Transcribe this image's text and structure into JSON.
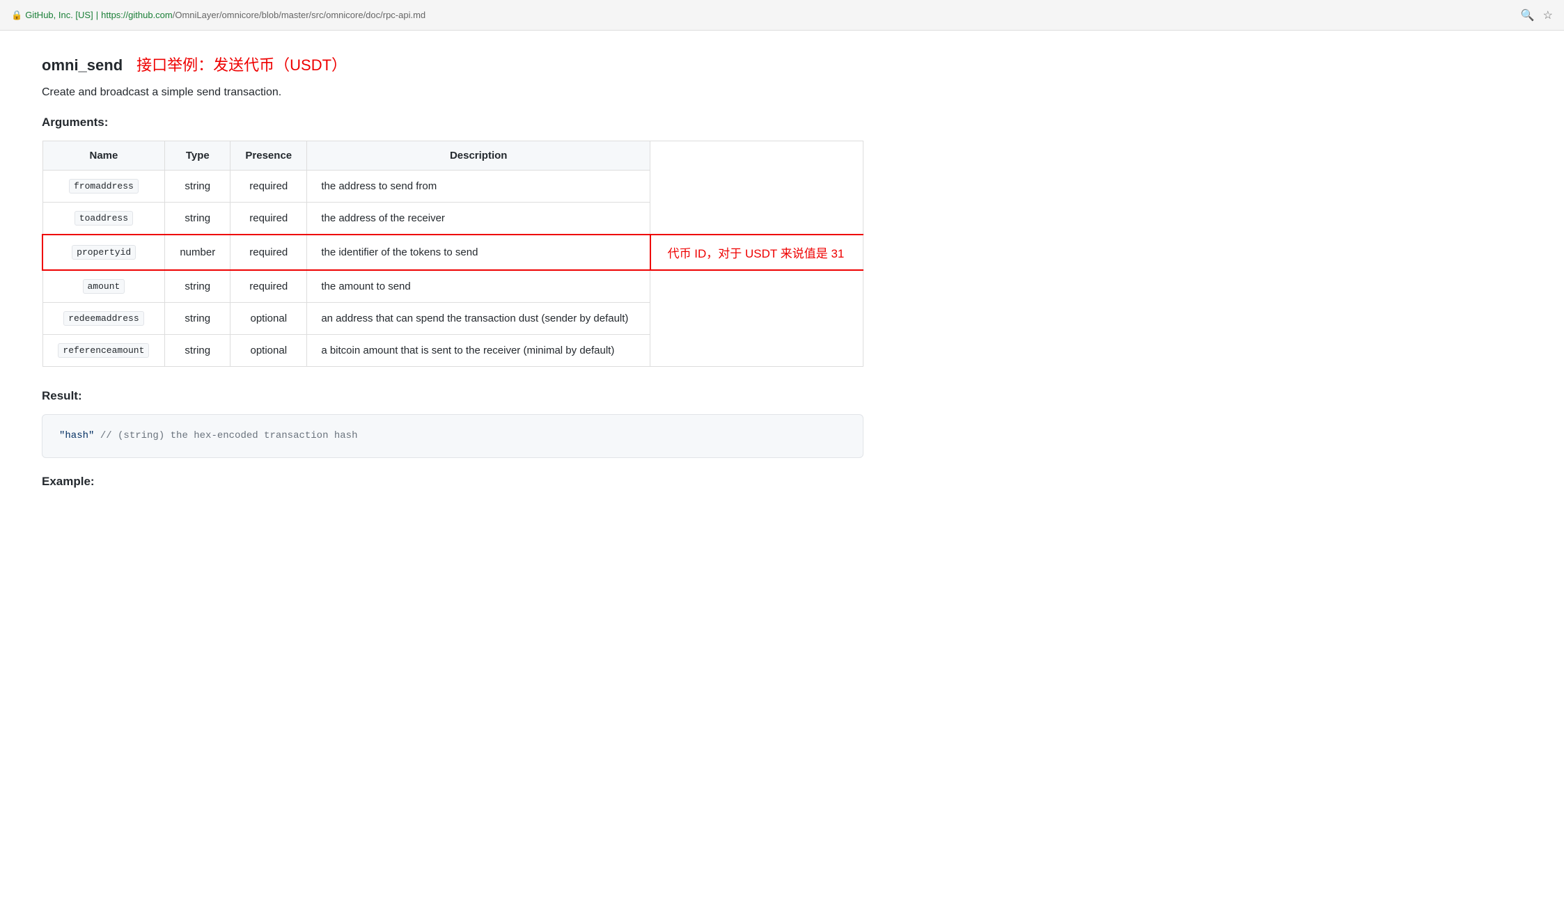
{
  "browser": {
    "security_label": "GitHub, Inc. [US]",
    "url_domain": "https://github.com",
    "url_path": "/OmniLayer/omnicore/blob/master/src/omnicore/doc/rpc-api.md",
    "search_icon": "🔍",
    "star_icon": "☆"
  },
  "page": {
    "api_title": "omni_send",
    "title_annotation": "接口举例：发送代币（USDT）",
    "description": "Create and broadcast a simple send transaction.",
    "arguments_heading": "Arguments:",
    "result_heading": "Result:",
    "example_heading": "Example:",
    "table": {
      "headers": [
        "Name",
        "Type",
        "Presence",
        "Description"
      ],
      "rows": [
        {
          "name": "fromaddress",
          "type": "string",
          "presence": "required",
          "description": "the address to send from",
          "highlighted": false
        },
        {
          "name": "toaddress",
          "type": "string",
          "presence": "required",
          "description": "the address of the receiver",
          "highlighted": false
        },
        {
          "name": "propertyid",
          "type": "number",
          "presence": "required",
          "description": "the identifier of the tokens to send",
          "highlighted": true,
          "annotation": "代币 ID，对于 USDT 来说值是 31"
        },
        {
          "name": "amount",
          "type": "string",
          "presence": "required",
          "description": "the amount to send",
          "highlighted": false
        },
        {
          "name": "redeemaddress",
          "type": "string",
          "presence": "optional",
          "description": "an address that can spend the transaction dust (sender by default)",
          "highlighted": false
        },
        {
          "name": "referenceamount",
          "type": "string",
          "presence": "optional",
          "description": "a bitcoin amount that is sent to the receiver (minimal by default)",
          "highlighted": false
        }
      ]
    },
    "result_code": "\"hash\"  // (string) the hex-encoded transaction hash"
  }
}
